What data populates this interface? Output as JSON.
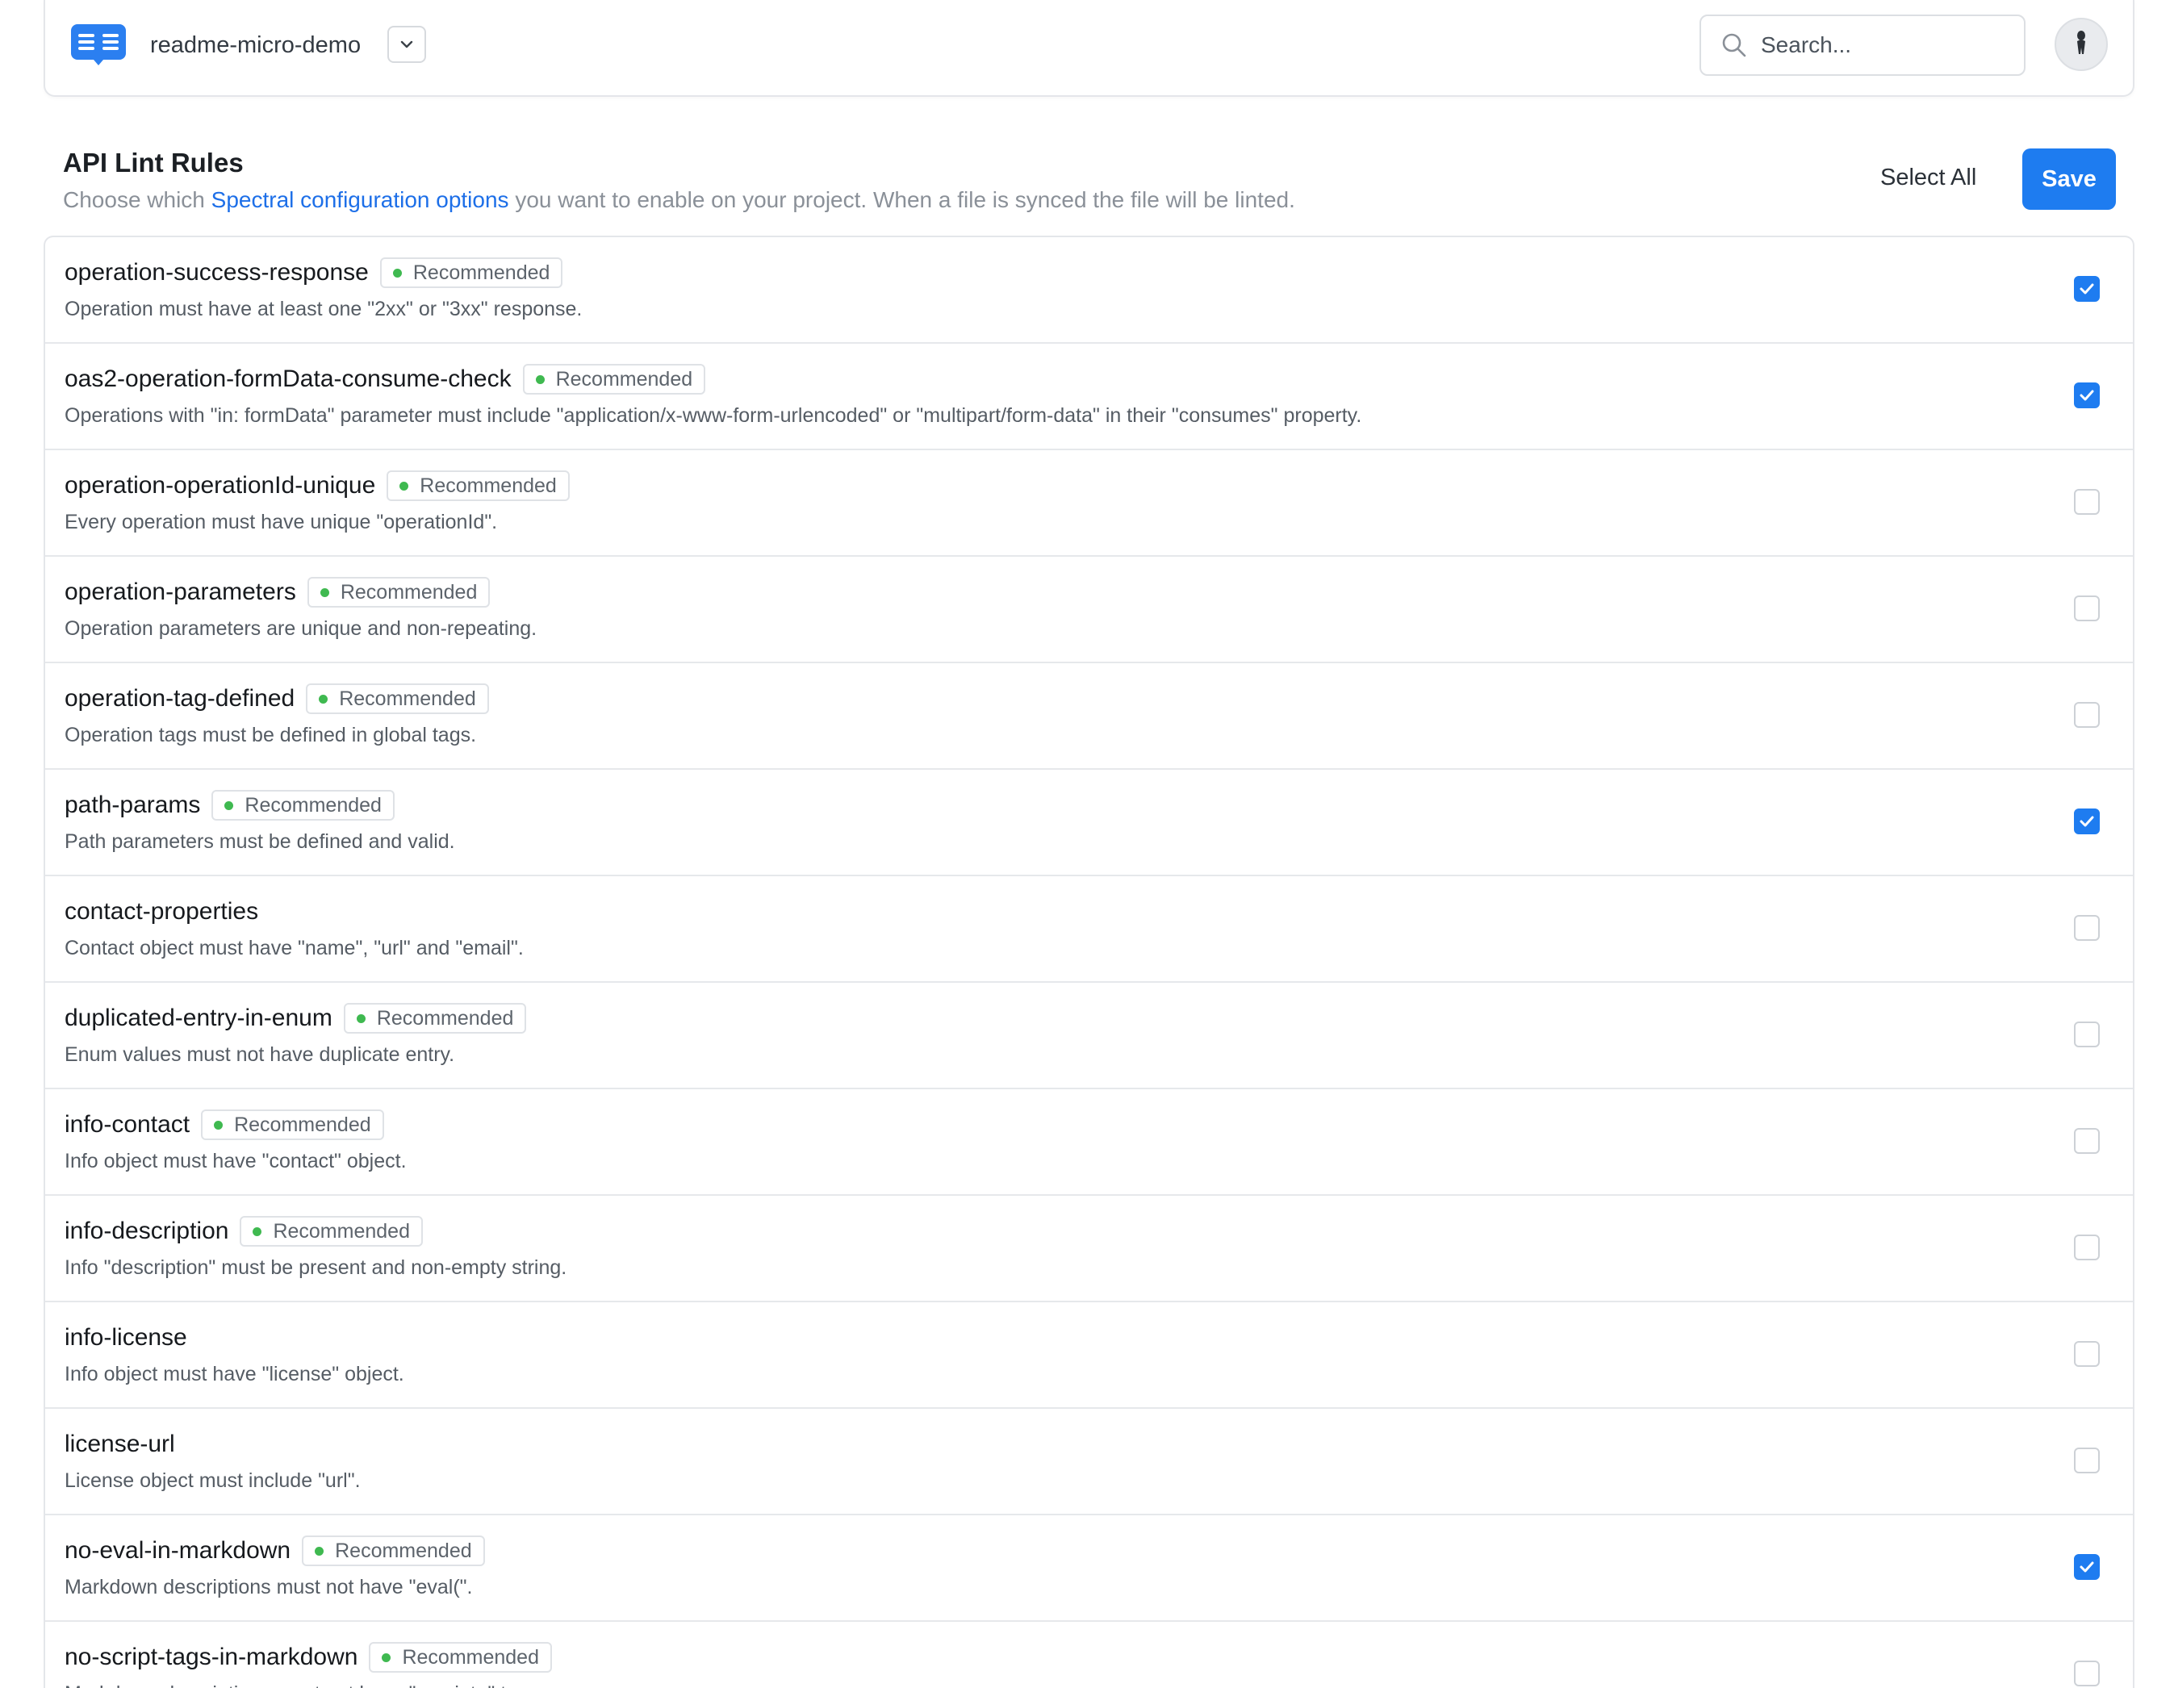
{
  "header": {
    "project_name": "readme-micro-demo",
    "search_placeholder": "Search..."
  },
  "section": {
    "title": "API Lint Rules",
    "desc_before": "Choose which ",
    "desc_link": "Spectral configuration options",
    "desc_after": " you want to enable on your project. When a file is synced the file will be linted.",
    "select_all_label": "Select All",
    "save_label": "Save"
  },
  "colors": {
    "accent": "#1e7cf0",
    "link": "#1d6fe8",
    "recommended_dot": "#3fb950"
  },
  "badge_label": "Recommended",
  "rules": [
    {
      "name": "operation-success-response",
      "recommended": true,
      "description": "Operation must have at least one \"2xx\" or \"3xx\" response.",
      "checked": true
    },
    {
      "name": "oas2-operation-formData-consume-check",
      "recommended": true,
      "description": "Operations with \"in: formData\" parameter must include \"application/x-www-form-urlencoded\" or \"multipart/form-data\" in their \"consumes\" property.",
      "checked": true
    },
    {
      "name": "operation-operationId-unique",
      "recommended": true,
      "description": "Every operation must have unique \"operationId\".",
      "checked": false
    },
    {
      "name": "operation-parameters",
      "recommended": true,
      "description": "Operation parameters are unique and non-repeating.",
      "checked": false
    },
    {
      "name": "operation-tag-defined",
      "recommended": true,
      "description": "Operation tags must be defined in global tags.",
      "checked": false
    },
    {
      "name": "path-params",
      "recommended": true,
      "description": "Path parameters must be defined and valid.",
      "checked": true
    },
    {
      "name": "contact-properties",
      "recommended": false,
      "description": "Contact object must have \"name\", \"url\" and \"email\".",
      "checked": false
    },
    {
      "name": "duplicated-entry-in-enum",
      "recommended": true,
      "description": "Enum values must not have duplicate entry.",
      "checked": false
    },
    {
      "name": "info-contact",
      "recommended": true,
      "description": "Info object must have \"contact\" object.",
      "checked": false
    },
    {
      "name": "info-description",
      "recommended": true,
      "description": "Info \"description\" must be present and non-empty string.",
      "checked": false
    },
    {
      "name": "info-license",
      "recommended": false,
      "description": "Info object must have \"license\" object.",
      "checked": false
    },
    {
      "name": "license-url",
      "recommended": false,
      "description": "License object must include \"url\".",
      "checked": false
    },
    {
      "name": "no-eval-in-markdown",
      "recommended": true,
      "description": "Markdown descriptions must not have \"eval(\".",
      "checked": true
    },
    {
      "name": "no-script-tags-in-markdown",
      "recommended": true,
      "description": "Markdown descriptions must not have \"<script>\" tags.",
      "checked": false
    }
  ]
}
